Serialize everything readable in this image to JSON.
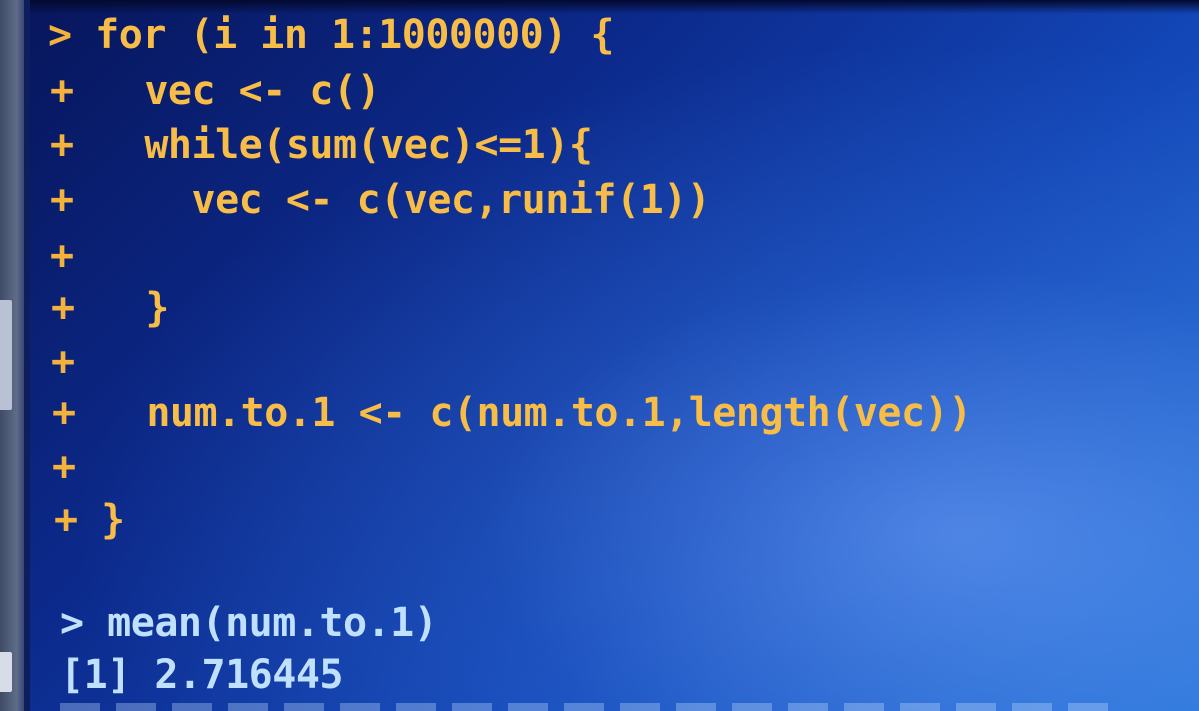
{
  "console": {
    "lines": [
      {
        "prompt": ">",
        "code": " for (i in 1:1000000) {"
      },
      {
        "prompt": "+",
        "code": "   vec <- c()"
      },
      {
        "prompt": "+",
        "code": "   while(sum(vec)<=1){"
      },
      {
        "prompt": "+",
        "code": "     vec <- c(vec,runif(1))"
      },
      {
        "prompt": "+",
        "code": ""
      },
      {
        "prompt": "+",
        "code": "   }"
      },
      {
        "prompt": "+",
        "code": ""
      },
      {
        "prompt": "+",
        "code": "   num.to.1 <- c(num.to.1,length(vec))"
      },
      {
        "prompt": "+",
        "code": ""
      },
      {
        "prompt": "+",
        "code": " }"
      },
      {
        "prompt": ">",
        "code": " mean(num.to.1)"
      }
    ],
    "output": "[1] 2.716445"
  },
  "colors": {
    "code_text": "#f3b23c",
    "output_text": "#bfe0ff",
    "background_dark": "#07155a",
    "background_light": "#2a78dc"
  }
}
